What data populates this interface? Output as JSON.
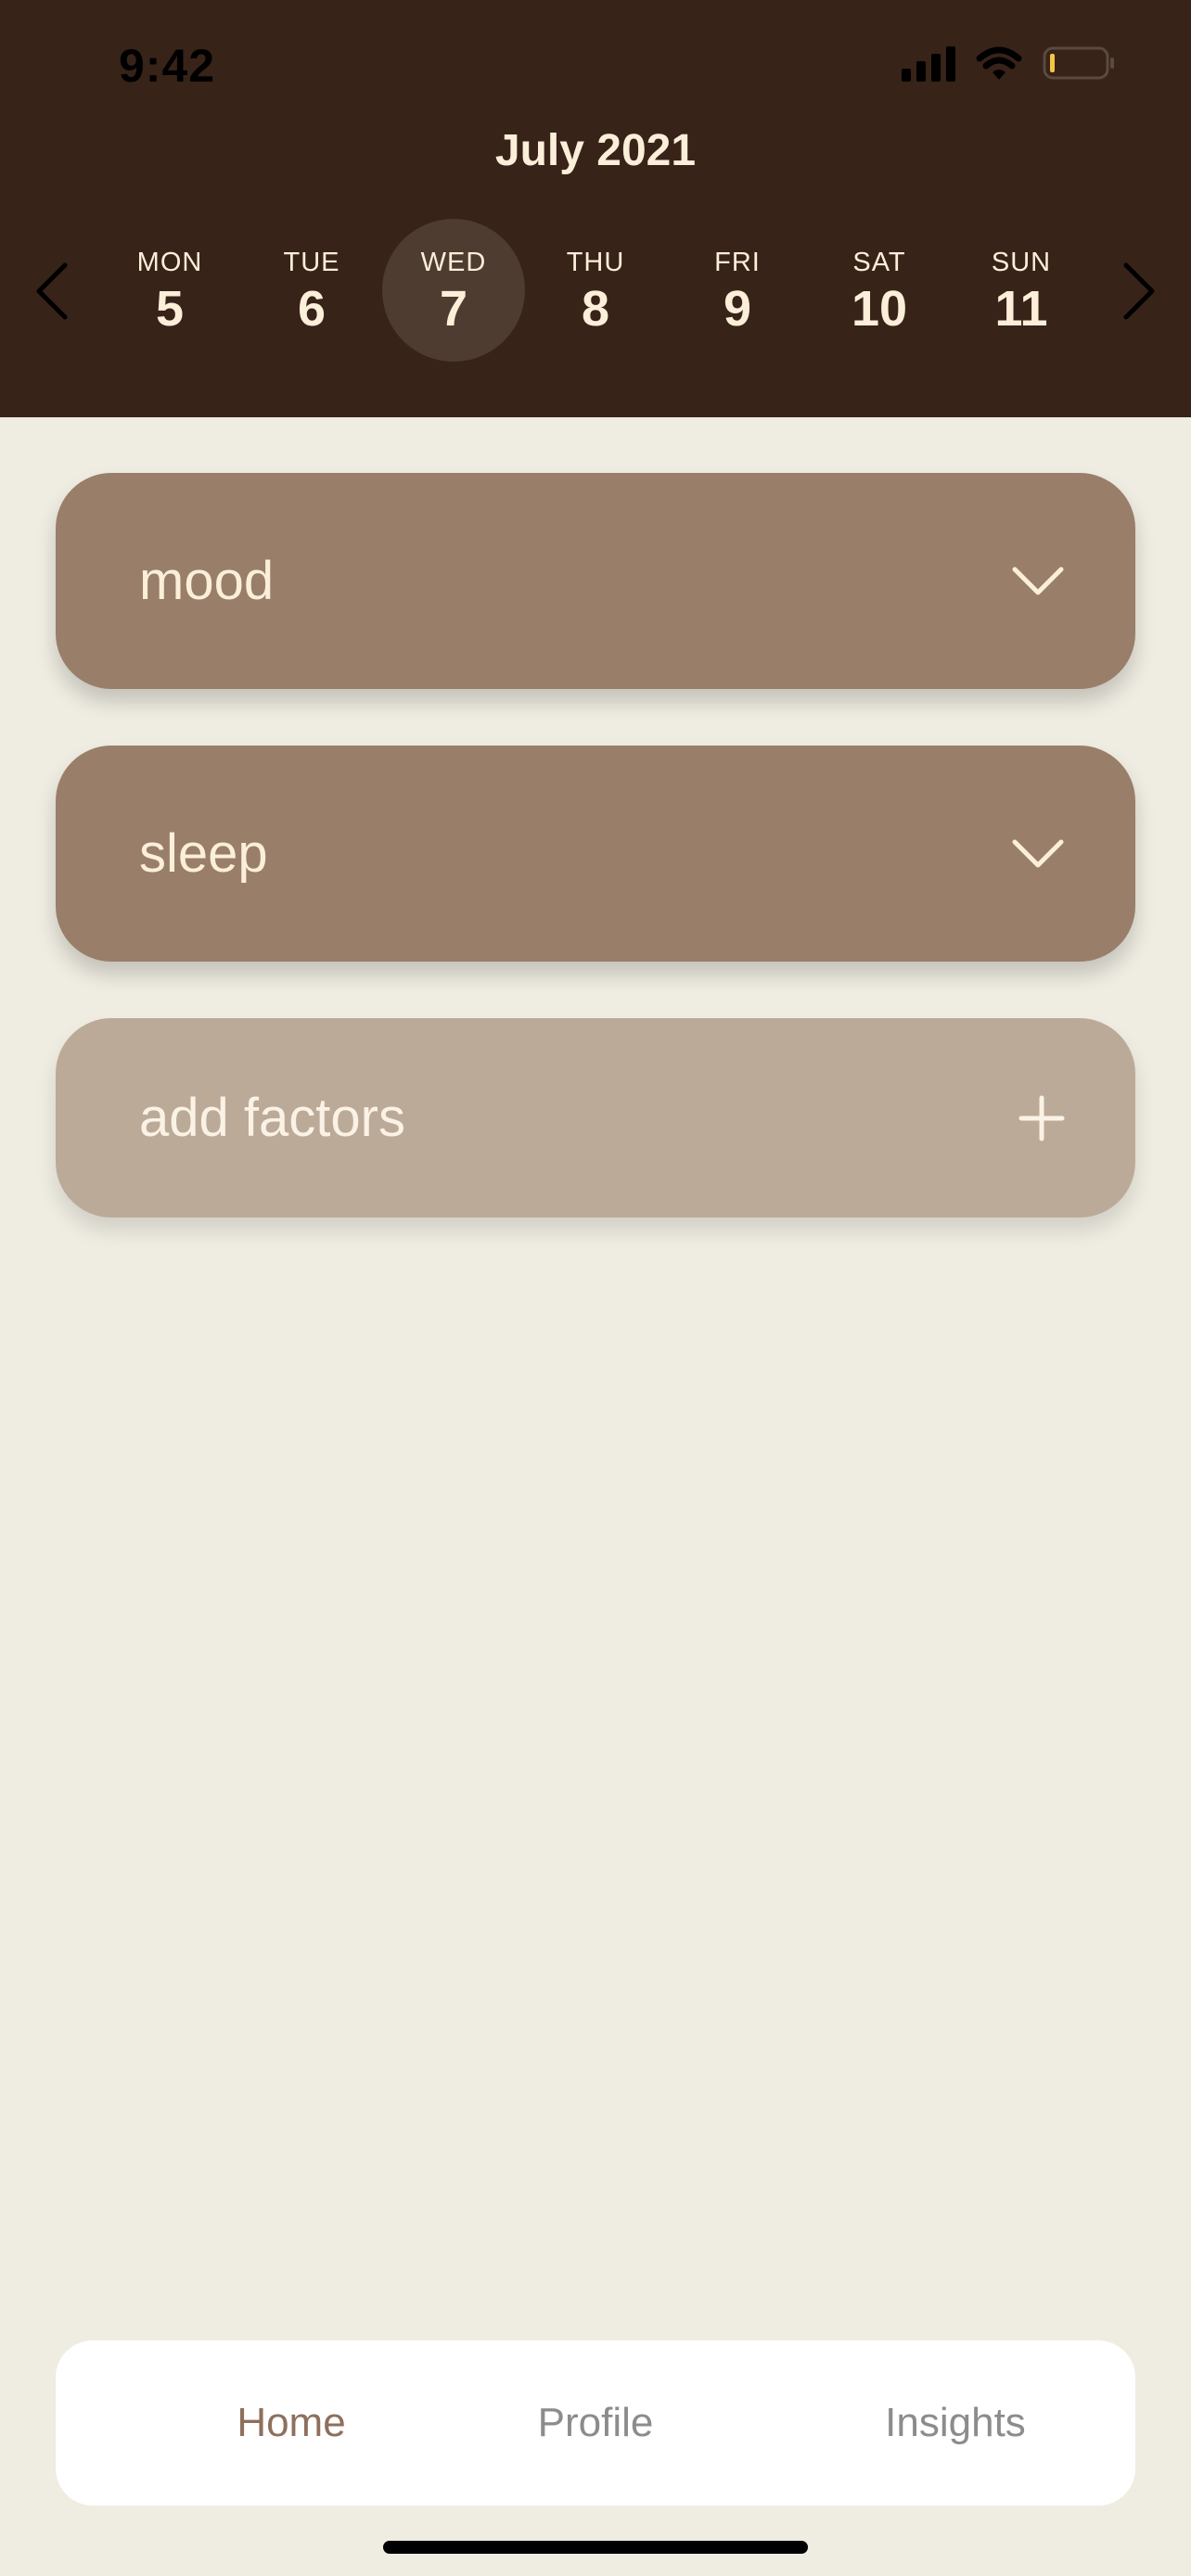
{
  "status_bar": {
    "time": "9:42"
  },
  "calendar": {
    "month_title": "July 2021",
    "days": [
      {
        "name": "MON",
        "num": "5"
      },
      {
        "name": "TUE",
        "num": "6"
      },
      {
        "name": "WED",
        "num": "7"
      },
      {
        "name": "THU",
        "num": "8"
      },
      {
        "name": "FRI",
        "num": "9"
      },
      {
        "name": "SAT",
        "num": "10"
      },
      {
        "name": "SUN",
        "num": "11"
      }
    ],
    "selected_day": "WED"
  },
  "cards": {
    "mood_label": "mood",
    "sleep_label": "sleep",
    "add_label": "add factors"
  },
  "tabbar": {
    "home": "Home",
    "profile": "Profile",
    "insights": "Insights",
    "active": "Home"
  },
  "colors": {
    "header_bg": "#382319",
    "page_bg": "#EFEDE2",
    "card_bg": "#997E6A",
    "add_card_bg": "#BCAA99",
    "text_light": "#FBEFD9",
    "tab_active": "#8E6F5D",
    "tab_inactive": "#8C8C8C"
  },
  "icons": {
    "prev": "chevron-left-icon",
    "next": "chevron-right-icon",
    "expand": "chevron-down-icon",
    "add": "plus-icon",
    "signal": "cellular-signal-icon",
    "wifi": "wifi-icon",
    "battery": "battery-icon"
  }
}
